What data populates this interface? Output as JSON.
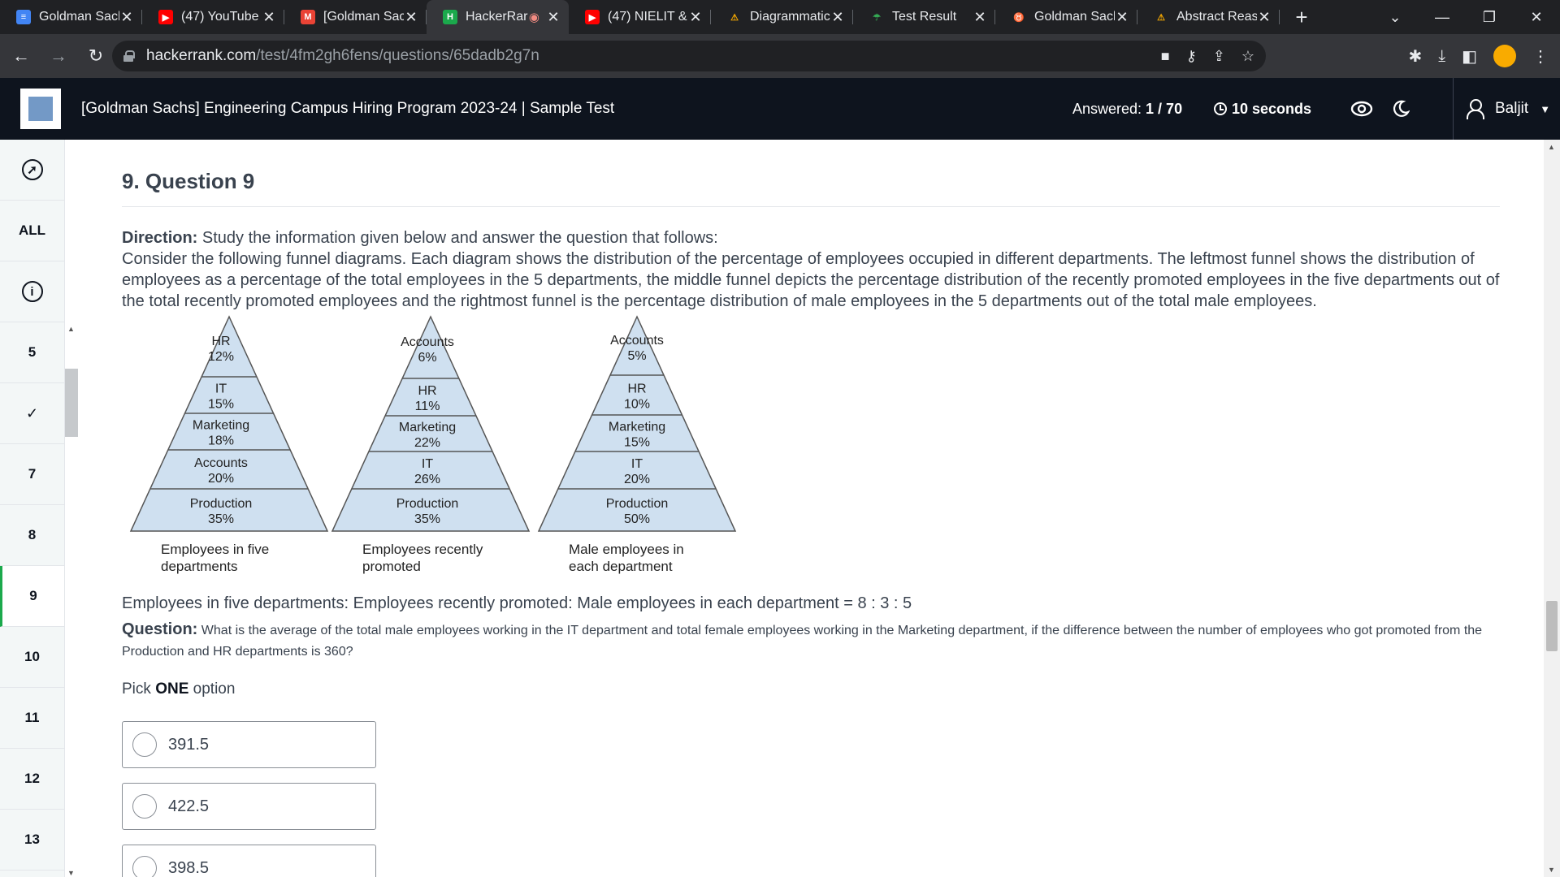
{
  "browser": {
    "tabs": [
      {
        "title": "Goldman Sach",
        "icon": "docs-icon",
        "color": "#4285f4"
      },
      {
        "title": "(47) YouTube",
        "icon": "youtube-icon",
        "color": "#ff0000"
      },
      {
        "title": "[Goldman Sac",
        "icon": "gmail-icon",
        "color": "#ea4335"
      },
      {
        "title": "HackerRar",
        "icon": "hackerrank-icon",
        "color": "#1ba94c",
        "active": true
      },
      {
        "title": "(47) NIELIT &",
        "icon": "youtube-icon",
        "color": "#ff0000"
      },
      {
        "title": "Diagrammatic",
        "icon": "warning-icon",
        "color": "#f9ab00"
      },
      {
        "title": "Test Result",
        "icon": "umbrella-icon",
        "color": "#34a853"
      },
      {
        "title": "Goldman Sacl",
        "icon": "bull-icon",
        "color": "#c5221f"
      },
      {
        "title": "Abstract Reas",
        "icon": "warning-icon",
        "color": "#f9ab00"
      }
    ],
    "url_domain": "hackerrank.com",
    "url_path": "/test/4fm2gh6fens/questions/65dadb2g7n"
  },
  "header": {
    "title": "[Goldman Sachs] Engineering Campus Hiring Program 2023-24 | Sample Test",
    "answered_label": "Answered:",
    "answered_value": "1 / 70",
    "timer": "10 seconds",
    "user": "Baljit"
  },
  "rail": {
    "all_label": "ALL",
    "items": [
      "5",
      "✓",
      "7",
      "8",
      "9",
      "10",
      "11",
      "12",
      "13"
    ],
    "active": "9"
  },
  "question": {
    "title": "9. Question 9",
    "direction_label": "Direction:",
    "direction_text": " Study the information given below and answer the question that follows:",
    "body": "Consider the following funnel diagrams. Each diagram shows the distribution of the percentage of employees occupied in different departments. The leftmost funnel shows the distribution of employees as a percentage of the total employees in the 5 departments, the middle funnel depicts the percentage distribution of the recently promoted employees in the five departments out of the total recently  promoted employees and the rightmost funnel is the percentage distribution of male employees in the 5 departments out of the total male employees.",
    "ratio_text": "Employees in five departments: Employees recently promoted: Male employees in each department = 8 : 3 : 5",
    "question_label": "Question:",
    "question_text": " What is the average of the total male employees working in the IT department and total female employees working in the Marketing department, if the difference between the number of employees who got promoted from the Production and HR departments is 360?",
    "pick_prefix": "Pick ",
    "pick_bold": "ONE",
    "pick_suffix": " option",
    "options": [
      "391.5",
      "422.5",
      "398.5"
    ]
  },
  "funnels": [
    {
      "caption": [
        "Employees in five",
        "departments"
      ],
      "levels": [
        {
          "name": "HR",
          "pct": "12%"
        },
        {
          "name": "IT",
          "pct": "15%"
        },
        {
          "name": "Marketing",
          "pct": "18%"
        },
        {
          "name": "Accounts",
          "pct": "20%"
        },
        {
          "name": "Production",
          "pct": "35%"
        }
      ]
    },
    {
      "caption": [
        "Employees recently",
        "promoted"
      ],
      "levels": [
        {
          "name": "Accounts",
          "pct": "6%"
        },
        {
          "name": "HR",
          "pct": "11%"
        },
        {
          "name": "Marketing",
          "pct": "22%"
        },
        {
          "name": "IT",
          "pct": "26%"
        },
        {
          "name": "Production",
          "pct": "35%"
        }
      ]
    },
    {
      "caption": [
        "Male employees in",
        "each department"
      ],
      "levels": [
        {
          "name": "Accounts",
          "pct": "5%"
        },
        {
          "name": "HR",
          "pct": "10%"
        },
        {
          "name": "Marketing",
          "pct": "15%"
        },
        {
          "name": "IT",
          "pct": "20%"
        },
        {
          "name": "Production",
          "pct": "50%"
        }
      ]
    }
  ],
  "colors": {
    "funnel_fill": "#cfe0f0",
    "funnel_stroke": "#555555",
    "accent": "#1ba94c",
    "header_bg": "#0e141e"
  }
}
